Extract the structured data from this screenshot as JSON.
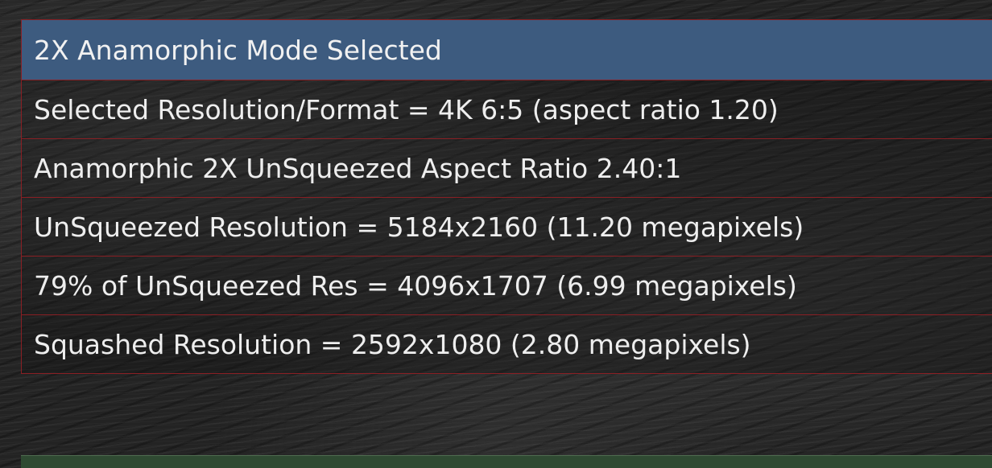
{
  "colors": {
    "header_bg": "#3d5b7f",
    "border": "#8a1f24",
    "text": "#eeeeee",
    "bottom_panel_bg": "#2f4a32"
  },
  "table": {
    "header": "2X Anamorphic Mode Selected",
    "rows": [
      "Selected Resolution/Format = 4K 6:5 (aspect ratio 1.20)",
      "Anamorphic 2X UnSqueezed Aspect Ratio 2.40:1",
      "UnSqueezed Resolution = 5184x2160 (11.20 megapixels)",
      "79% of UnSqueezed Res = 4096x1707 (6.99 megapixels)",
      "Squashed Resolution = 2592x1080 (2.80 megapixels)"
    ]
  }
}
